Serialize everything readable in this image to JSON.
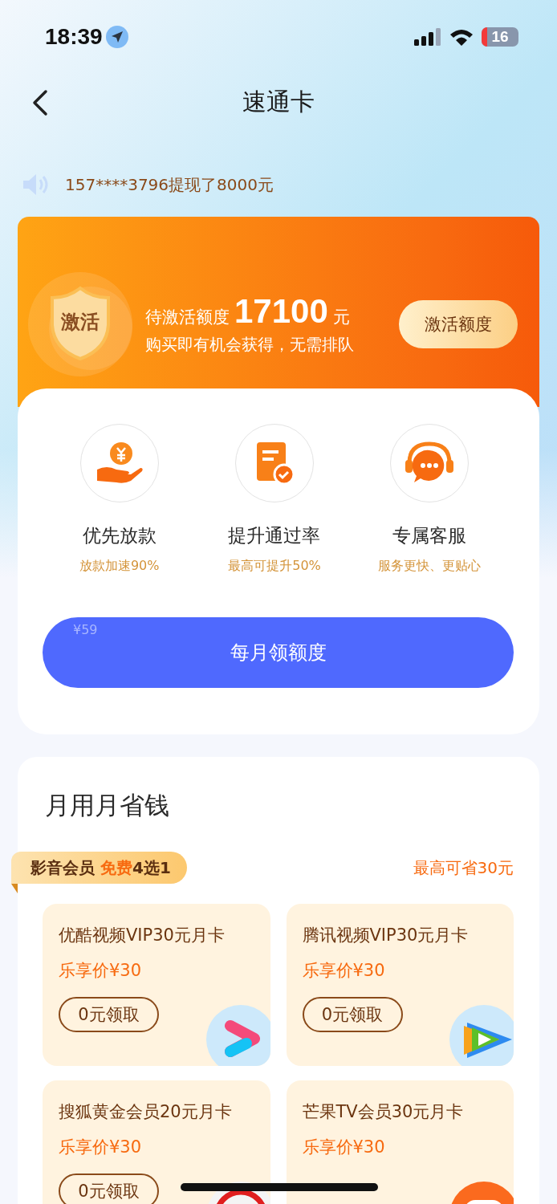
{
  "status_bar": {
    "time": "18:39",
    "battery": "16"
  },
  "nav": {
    "title": "速通卡"
  },
  "ticker": {
    "text": "157****3796提现了8000元"
  },
  "promo": {
    "badge": "激活",
    "label": "待激活额度",
    "amount": "17100",
    "unit": "元",
    "subtitle": "购买即有机会获得，无需排队",
    "button": "激活额度"
  },
  "benefits": [
    {
      "kind": "hand",
      "title": "优先放款",
      "subtitle": "放款加速90%"
    },
    {
      "kind": "document",
      "title": "提升通过率",
      "subtitle": "最高可提升50%"
    },
    {
      "kind": "headset",
      "title": "专属客服",
      "subtitle": "服务更快、更贴心"
    }
  ],
  "cta": {
    "price": "¥59",
    "label": "每月领额度"
  },
  "savings": {
    "title": "月用月省钱",
    "ribbon": "影音会员 **免费**4选1",
    "note": "最高可省30元",
    "items": [
      {
        "kind": "chevron",
        "name": "优酷视频VIP30元月卡",
        "price": "乐享价¥30",
        "button": "0元领取"
      },
      {
        "kind": "triangle",
        "name": "腾讯视频VIP30元月卡",
        "price": "乐享价¥30",
        "button": "0元领取"
      },
      {
        "kind": "ring",
        "name": "搜狐黄金会员20元月卡",
        "price": "乐享价¥30",
        "button": "0元领取"
      },
      {
        "kind": "badge",
        "name": "芒果TV会员30元月卡",
        "price": "乐享价¥30"
      }
    ]
  }
}
